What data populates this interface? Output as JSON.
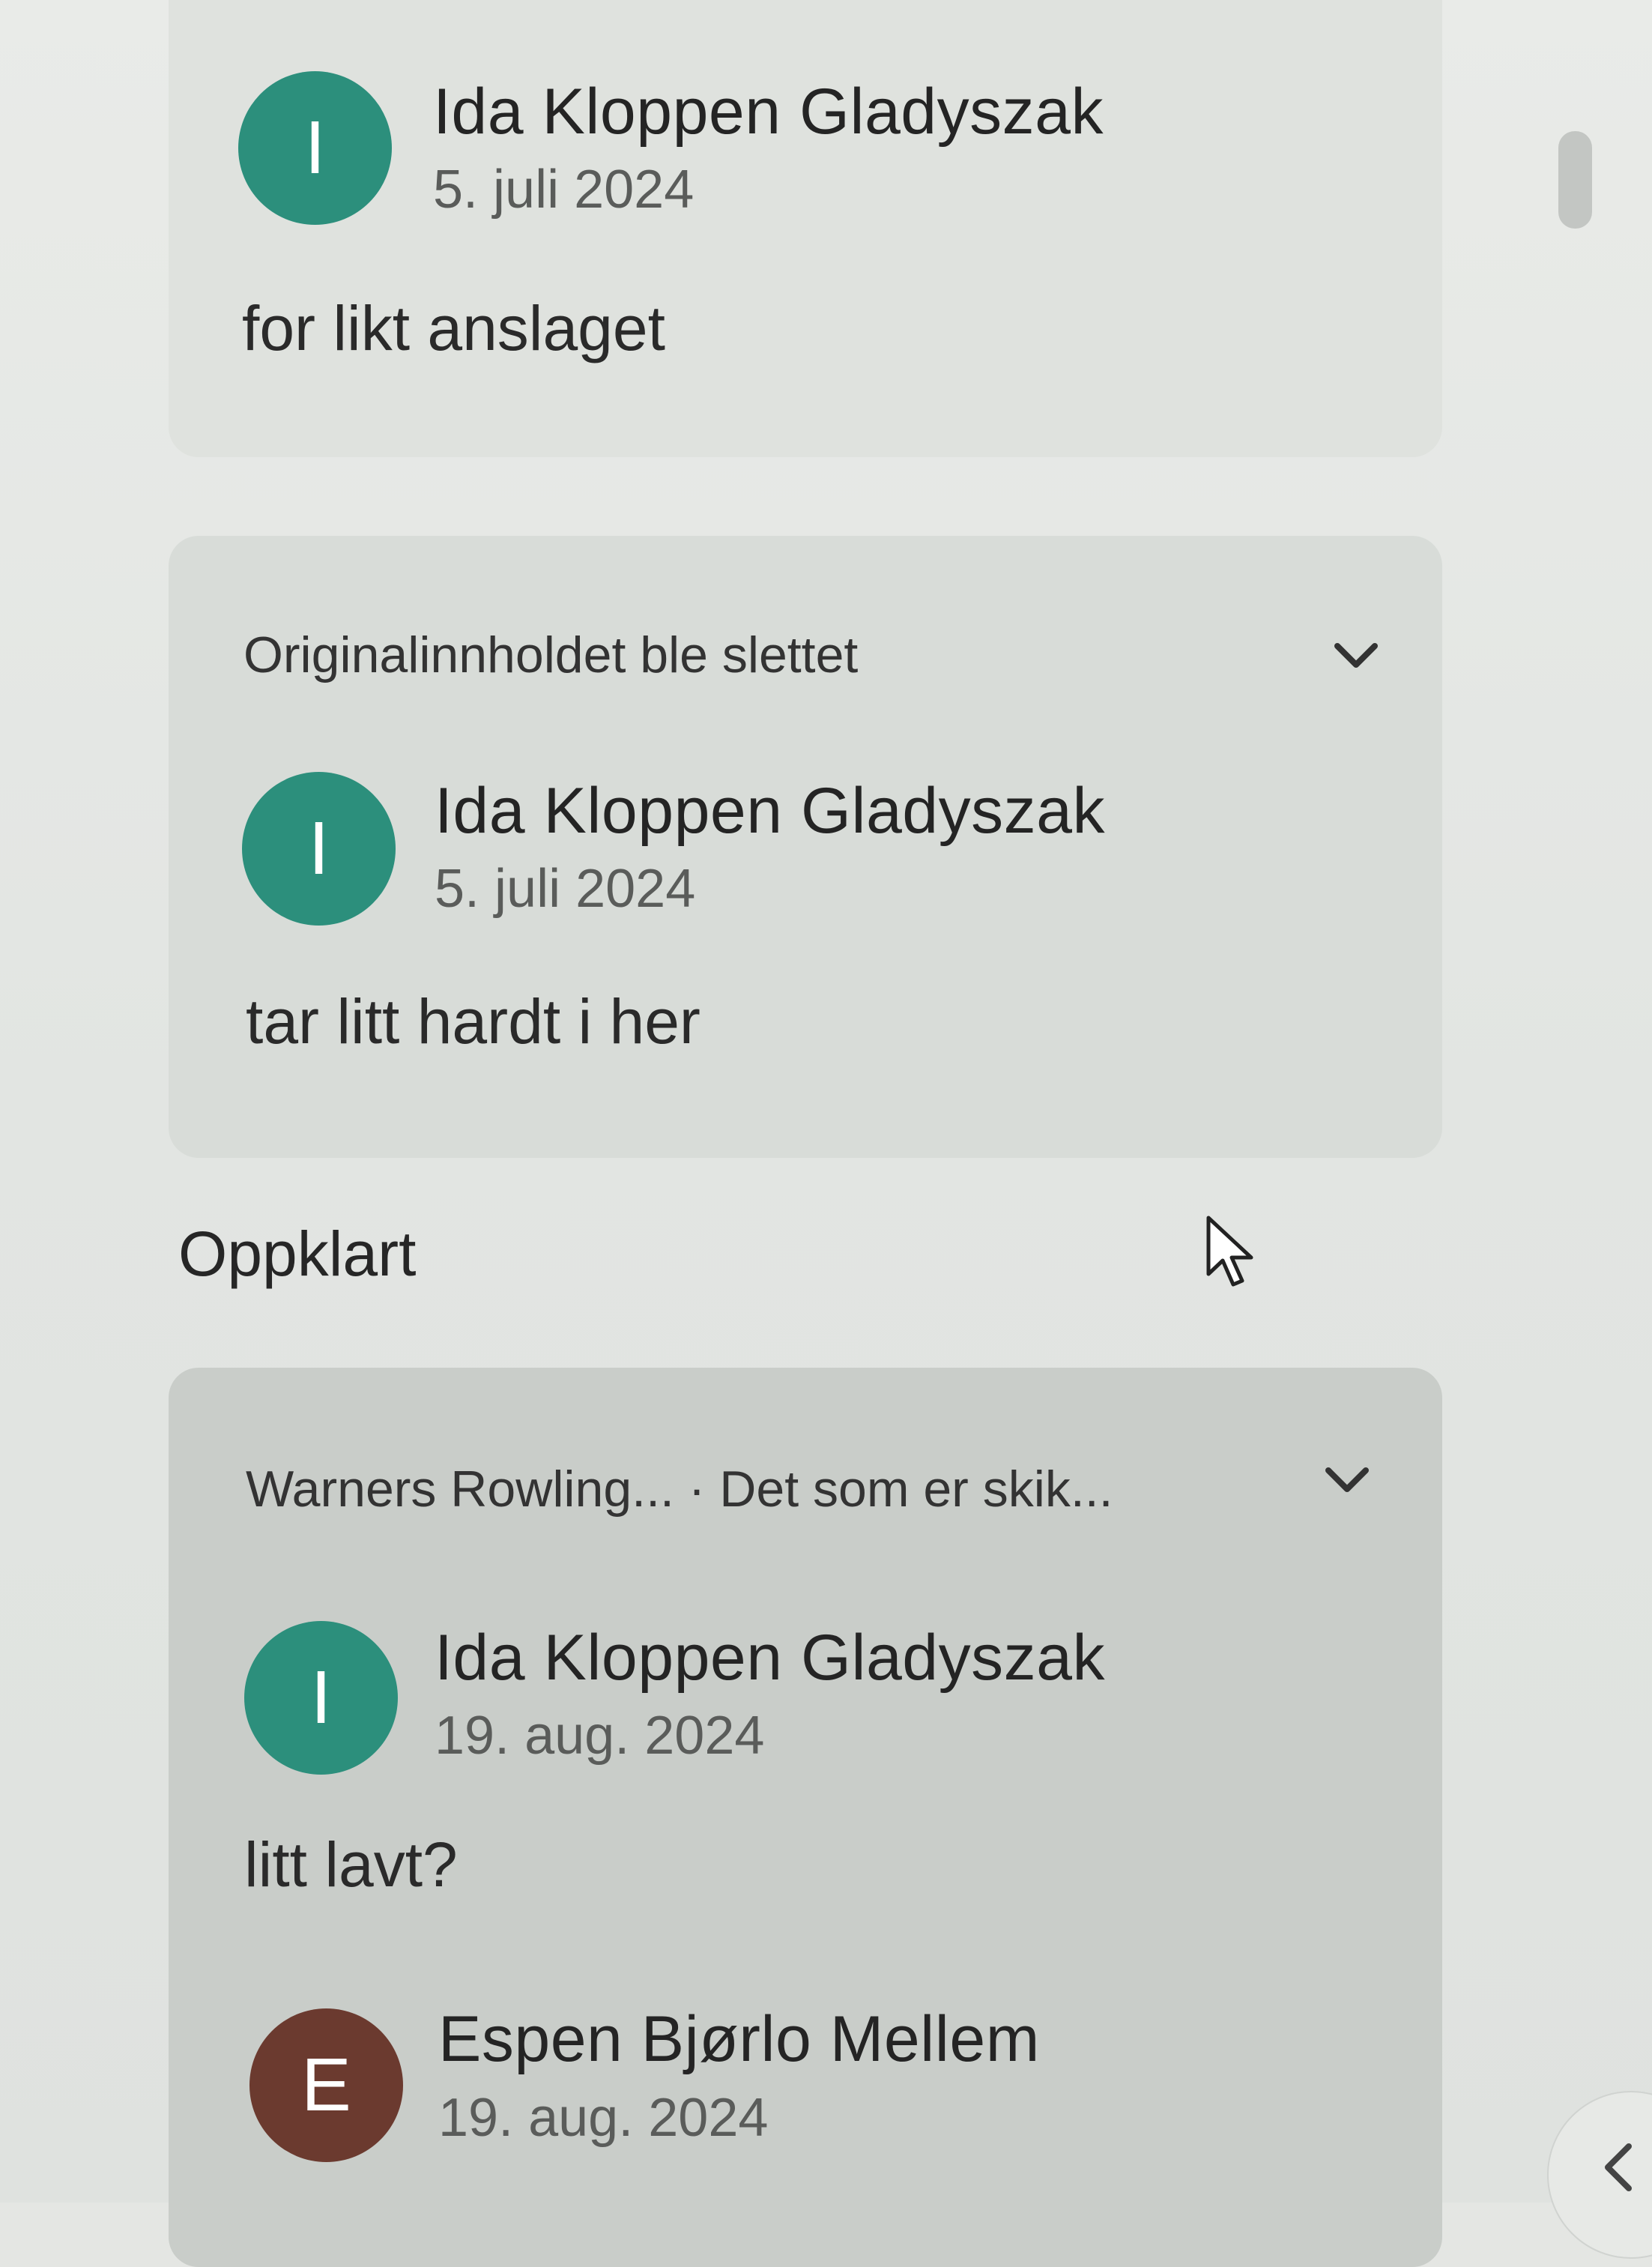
{
  "comments_panel": {
    "thread1": {
      "author_initial": "I",
      "author": "Ida Kloppen Gladyszak",
      "date": "5. juli 2024",
      "text": "for likt anslaget"
    },
    "thread2": {
      "header": "Originalinnholdet ble slettet",
      "author_initial": "I",
      "author": "Ida Kloppen Gladyszak",
      "date": "5. juli 2024",
      "text": "tar litt hardt i her"
    },
    "resolved_section": {
      "title": "Oppklart"
    },
    "thread3": {
      "header": "Warners Rowling...  · Det som er skik...",
      "comment1": {
        "author_initial": "I",
        "author": "Ida Kloppen Gladyszak",
        "date": "19. aug. 2024",
        "text": "litt lavt?"
      },
      "comment2": {
        "author_initial": "E",
        "author": "Espen Bjørlo Mellem",
        "date": "19. aug. 2024"
      }
    }
  },
  "colors": {
    "avatar_teal": "#2c8f7c",
    "avatar_brown": "#6b3a2f"
  },
  "icons": {
    "expand": "chevron-down-icon",
    "collapse_sidebar": "chevron-left-icon",
    "cursor": "mouse-pointer-icon"
  }
}
